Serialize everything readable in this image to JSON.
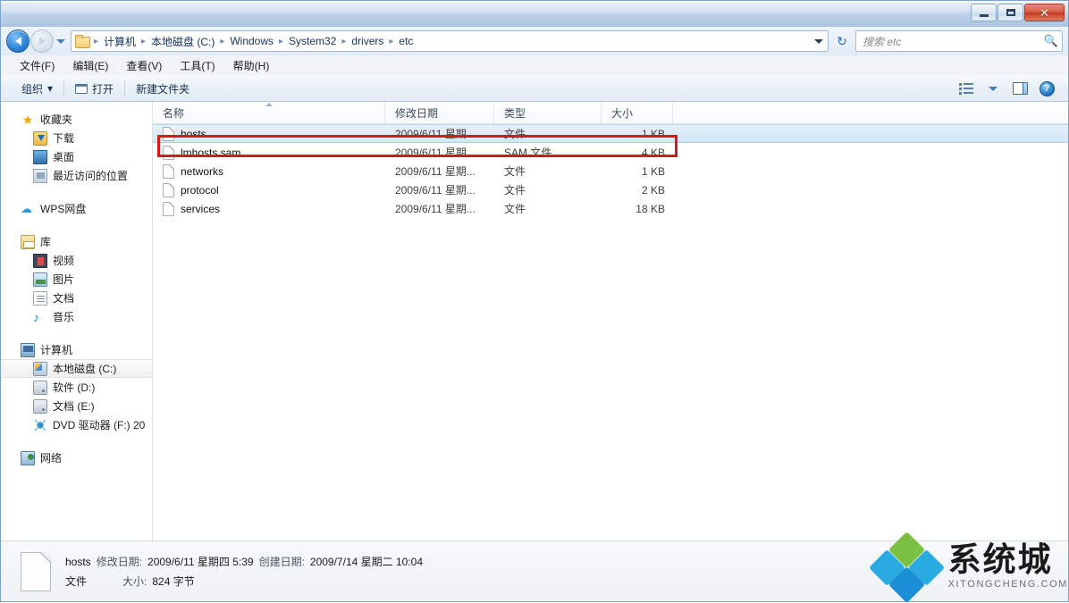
{
  "window": {
    "minimize_label": "最小化",
    "maximize_label": "最大化",
    "close_label": "✕"
  },
  "address": {
    "back_label": "后退",
    "forward_label": "前进",
    "history_label": "最近浏览的位置",
    "breadcrumbs": [
      "计算机",
      "本地磁盘 (C:)",
      "Windows",
      "System32",
      "drivers",
      "etc"
    ],
    "separator": "▸",
    "refresh_label": "↻",
    "dropdown_label": "▾"
  },
  "search": {
    "placeholder": "搜索 etc",
    "icon": "search-icon",
    "glyph": "🔍"
  },
  "menu": {
    "items": [
      {
        "label": "文件(F)"
      },
      {
        "label": "编辑(E)"
      },
      {
        "label": "查看(V)"
      },
      {
        "label": "工具(T)"
      },
      {
        "label": "帮助(H)"
      }
    ]
  },
  "toolbar": {
    "organize_label": "组织",
    "organize_caret": "▾",
    "open_label": "打开",
    "new_folder_label": "新建文件夹",
    "view_label": "更改您的视图",
    "view_caret": "▾",
    "preview_label": "显示预览窗格",
    "help_label": "?"
  },
  "sidebar": {
    "groups": [
      {
        "header": {
          "label": "收藏夹",
          "icon": "star-icon"
        },
        "items": [
          {
            "label": "下载",
            "icon": "download-icon"
          },
          {
            "label": "桌面",
            "icon": "desktop-icon"
          },
          {
            "label": "最近访问的位置",
            "icon": "recent-places-icon"
          }
        ]
      },
      {
        "header": {
          "label": "WPS网盘",
          "icon": "cloud-icon"
        },
        "items": []
      },
      {
        "header": {
          "label": "库",
          "icon": "library-icon"
        },
        "items": [
          {
            "label": "视频",
            "icon": "video-icon"
          },
          {
            "label": "图片",
            "icon": "pictures-icon"
          },
          {
            "label": "文档",
            "icon": "documents-icon"
          },
          {
            "label": "音乐",
            "icon": "music-icon"
          }
        ]
      },
      {
        "header": {
          "label": "计算机",
          "icon": "computer-icon"
        },
        "items": [
          {
            "label": "本地磁盘 (C:)",
            "icon": "system-drive-icon",
            "selected": true
          },
          {
            "label": "软件 (D:)",
            "icon": "drive-icon"
          },
          {
            "label": "文档 (E:)",
            "icon": "drive-icon"
          },
          {
            "label": "DVD 驱动器 (F:) 20",
            "icon": "dvd-drive-icon"
          }
        ]
      },
      {
        "header": {
          "label": "网络",
          "icon": "network-icon"
        },
        "items": []
      }
    ]
  },
  "filelist": {
    "columns": [
      {
        "key": "name",
        "label": "名称",
        "sorted": "asc"
      },
      {
        "key": "date",
        "label": "修改日期"
      },
      {
        "key": "type",
        "label": "类型"
      },
      {
        "key": "size",
        "label": "大小"
      }
    ],
    "rows": [
      {
        "name": "hosts",
        "date": "2009/6/11 星期...",
        "type": "文件",
        "size": "1 KB",
        "selected": true,
        "annotated": true
      },
      {
        "name": "lmhosts.sam",
        "date": "2009/6/11 星期...",
        "type": "SAM 文件",
        "size": "4 KB",
        "selected": false,
        "annotated": false
      },
      {
        "name": "networks",
        "date": "2009/6/11 星期...",
        "type": "文件",
        "size": "1 KB",
        "selected": false,
        "annotated": false
      },
      {
        "name": "protocol",
        "date": "2009/6/11 星期...",
        "type": "文件",
        "size": "2 KB",
        "selected": false,
        "annotated": false
      },
      {
        "name": "services",
        "date": "2009/6/11 星期...",
        "type": "文件",
        "size": "18 KB",
        "selected": false,
        "annotated": false
      }
    ]
  },
  "details": {
    "file_name": "hosts",
    "modified_label": "修改日期:",
    "modified_value": "2009/6/11 星期四 5:39",
    "created_label": "创建日期:",
    "created_value": "2009/7/14 星期二 10:04",
    "kind": "文件",
    "size_label": "大小:",
    "size_value": "824 字节"
  },
  "watermark": {
    "cn": "系统城",
    "en": "XITONGCHENG.COM",
    "colors": {
      "green": "#7ac143",
      "blue": "#29abe2",
      "deep_blue": "#1b8fd6"
    }
  },
  "colors": {
    "annotation": "#d51a17",
    "selection": "#d2e7f8",
    "titlebar": "#aec6e2"
  }
}
